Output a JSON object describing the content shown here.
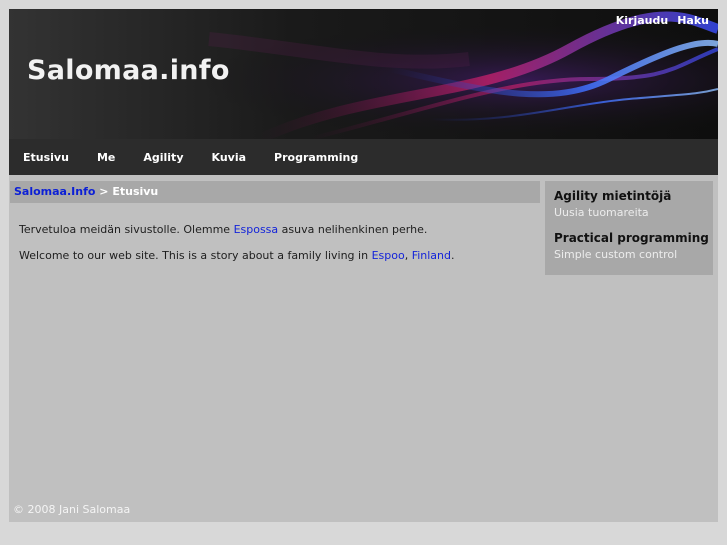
{
  "site": {
    "title": "Salomaa.info"
  },
  "top_links": {
    "login": "Kirjaudu",
    "search": "Haku"
  },
  "nav": {
    "items": [
      "Etusivu",
      "Me",
      "Agility",
      "Kuvia",
      "Programming"
    ]
  },
  "breadcrumb": {
    "home": "Salomaa.Info",
    "separator": ">",
    "current": "Etusivu"
  },
  "content": {
    "p1_before": "Tervetuloa meidän sivustolle. Olemme ",
    "p1_link": "Espossa",
    "p1_after": " asuva nelihenkinen perhe.",
    "p2_before": "Welcome to our web site. This is a story about a family living in ",
    "p2_link1": "Espoo",
    "p2_comma": ", ",
    "p2_link2": "Finland",
    "p2_after": "."
  },
  "sidebar": {
    "sections": [
      {
        "title": "Agility mietintöjä",
        "link": "Uusia tuomareita"
      },
      {
        "title": "Practical programming",
        "link": "Simple custom control"
      }
    ]
  },
  "footer": {
    "copyright": "© 2008 Jani Salomaa"
  },
  "colors": {
    "link": "#1424d9",
    "nav_bg": "#2c2c2c",
    "panel_bg": "#a8a8a8",
    "page_bg": "#c0c0c0"
  }
}
